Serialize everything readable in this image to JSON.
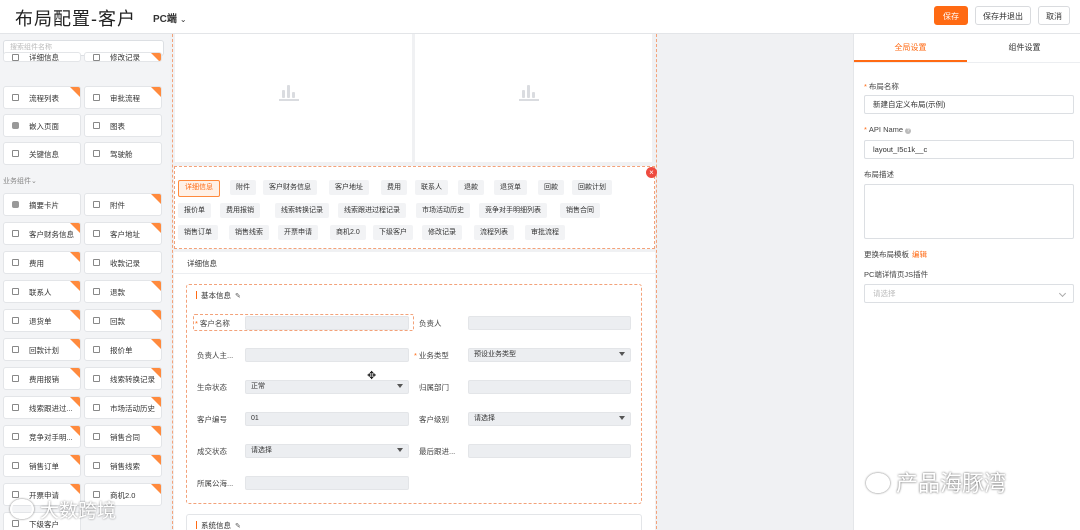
{
  "header": {
    "title": "布局配置-客户",
    "platform": "PC端",
    "save": "保存",
    "save_exit": "保存并退出",
    "cancel": "取消"
  },
  "left_panel": {
    "search_placeholder": "搜索组件名称",
    "group_label": "业务组件",
    "top_items": [
      {
        "label": "详细信息",
        "badge": false,
        "icon": "component-icon"
      },
      {
        "label": "修改记录",
        "badge": true,
        "icon": "component-icon"
      },
      {
        "label": "流程列表",
        "badge": true,
        "icon": "component-icon"
      },
      {
        "label": "审批流程",
        "badge": true,
        "icon": "component-icon"
      },
      {
        "label": "嵌入页面",
        "badge": false,
        "icon": "embed-icon"
      },
      {
        "label": "图表",
        "badge": false,
        "icon": "component-icon"
      },
      {
        "label": "关键信息",
        "badge": false,
        "icon": "component-icon"
      },
      {
        "label": "驾驶舱",
        "badge": false,
        "icon": "component-icon"
      }
    ],
    "business_items": [
      {
        "label": "摘要卡片",
        "badge": false,
        "icon": "embed-icon"
      },
      {
        "label": "附件",
        "badge": true,
        "icon": "component-icon"
      },
      {
        "label": "客户财务信息",
        "badge": true,
        "icon": "component-icon"
      },
      {
        "label": "客户地址",
        "badge": true,
        "icon": "component-icon"
      },
      {
        "label": "费用",
        "badge": true,
        "icon": "component-icon"
      },
      {
        "label": "收款记录",
        "badge": false,
        "icon": "component-icon"
      },
      {
        "label": "联系人",
        "badge": true,
        "icon": "component-icon"
      },
      {
        "label": "退款",
        "badge": true,
        "icon": "component-icon"
      },
      {
        "label": "退货单",
        "badge": true,
        "icon": "component-icon"
      },
      {
        "label": "回款",
        "badge": true,
        "icon": "component-icon"
      },
      {
        "label": "回款计划",
        "badge": true,
        "icon": "component-icon"
      },
      {
        "label": "报价单",
        "badge": true,
        "icon": "component-icon"
      },
      {
        "label": "费用报销",
        "badge": true,
        "icon": "component-icon"
      },
      {
        "label": "线索转换记录",
        "badge": true,
        "icon": "component-icon"
      },
      {
        "label": "线索跟进过...",
        "badge": true,
        "icon": "component-icon"
      },
      {
        "label": "市场活动历史",
        "badge": true,
        "icon": "component-icon"
      },
      {
        "label": "竞争对手明...",
        "badge": true,
        "icon": "component-icon"
      },
      {
        "label": "销售合同",
        "badge": true,
        "icon": "component-icon"
      },
      {
        "label": "销售订单",
        "badge": true,
        "icon": "component-icon"
      },
      {
        "label": "销售线索",
        "badge": true,
        "icon": "component-icon"
      },
      {
        "label": "开票申请",
        "badge": true,
        "icon": "component-icon"
      },
      {
        "label": "商机2.0",
        "badge": true,
        "icon": "component-icon"
      },
      {
        "label": "下级客户",
        "badge": false,
        "icon": "component-icon"
      }
    ]
  },
  "canvas": {
    "tabs_row1": [
      "详细信息",
      "附件",
      "客户财务信息",
      "客户地址",
      "费用",
      "联系人",
      "退款",
      "退货单",
      "回款",
      "回款计划"
    ],
    "tabs_row2": [
      "报价单",
      "费用报销",
      "线索转换记录",
      "线索跟进过程记录",
      "市场活动历史",
      "竞争对手明细列表",
      "销售合同"
    ],
    "tabs_row3": [
      "销售订单",
      "销售线索",
      "开票申请",
      "商机2.0",
      "下级客户",
      "修改记录",
      "流程列表",
      "审批流程"
    ],
    "detail_title": "详细信息",
    "basic_section": "基本信息",
    "system_section": "系统信息",
    "fields": {
      "customer_name": {
        "label": "客户名称",
        "value": ""
      },
      "owner": {
        "label": "负责人",
        "value": ""
      },
      "owner_main": {
        "label": "负责人主...",
        "value": ""
      },
      "biz_type": {
        "label": "业务类型",
        "value": "预设业务类型"
      },
      "lifecycle": {
        "label": "生命状态",
        "value": "正常"
      },
      "dept": {
        "label": "归属部门",
        "value": ""
      },
      "customer_no": {
        "label": "客户编号",
        "value": "01"
      },
      "customer_level": {
        "label": "客户级别",
        "value": "请选择"
      },
      "deal_status": {
        "label": "成交状态",
        "value": "请选择"
      },
      "last_follow": {
        "label": "最后跟进...",
        "value": ""
      },
      "public_pool": {
        "label": "所属公海...",
        "value": ""
      }
    }
  },
  "right_panel": {
    "tab_global": "全局设置",
    "tab_component": "组件设置",
    "layout_name_label": "布局名称",
    "layout_name_value": "新建自定义布局(示例)",
    "api_name_label": "API Name",
    "api_name_value": "layout_I5c1k__c",
    "desc_label": "布局描述",
    "change_template": "更换布局模板",
    "edit_link": "编辑",
    "js_plugin_label": "PC端详情页JS插件",
    "js_plugin_placeholder": "请选择"
  },
  "watermarks": {
    "left": "大数跨境",
    "right": "产品海豚湾"
  },
  "colors": {
    "accent": "#ff6a13",
    "badge": "#ff8a3d",
    "close": "#ee4b3f"
  }
}
